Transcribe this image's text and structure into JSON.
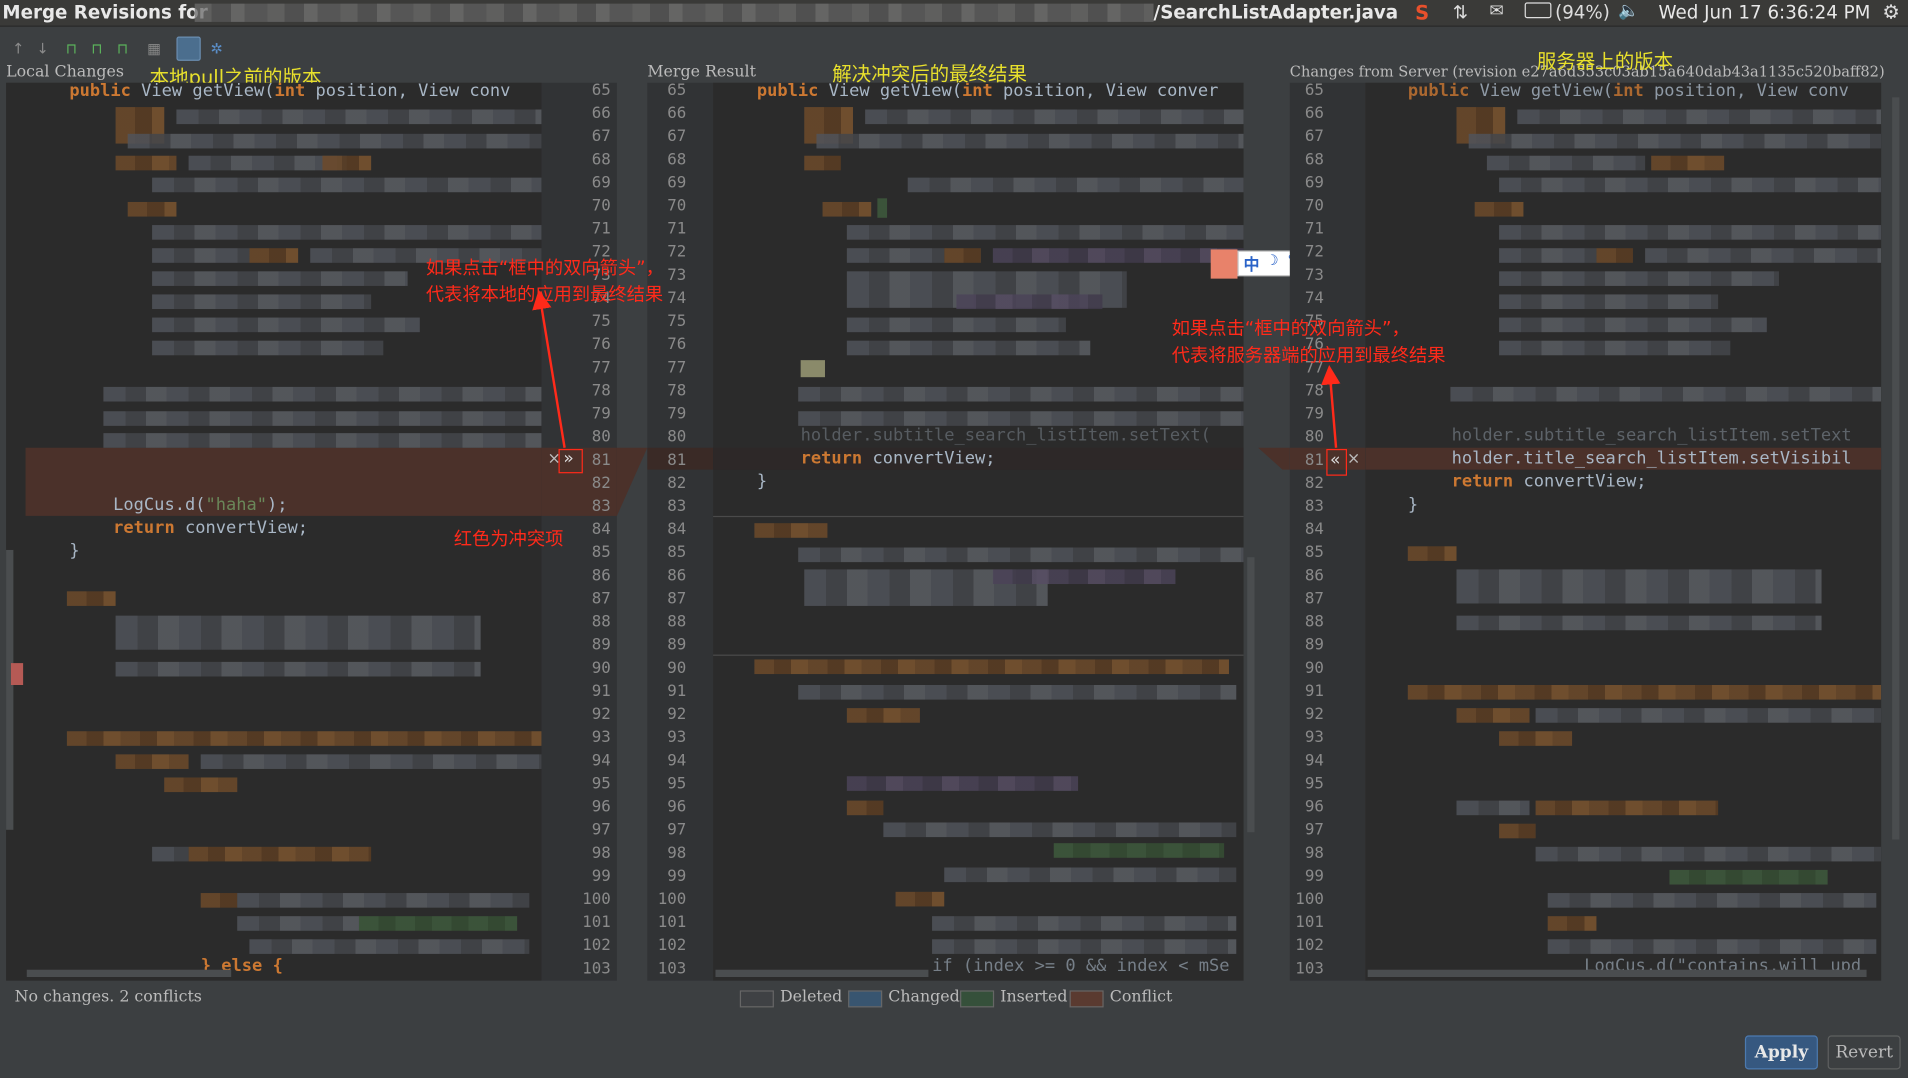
{
  "window": {
    "title_prefix": "Merge Revisions for",
    "file_suffix": "/SearchListAdapter.java",
    "battery": "(94%)",
    "clock": "Wed Jun 17  6:36:24 PM",
    "icons": [
      "sogou-s-icon",
      "network-icon",
      "mail-icon",
      "battery-icon",
      "volume-icon",
      "system-gear-icon"
    ]
  },
  "toolbar": {
    "icons": [
      "prev-arrow-icon",
      "next-arrow-icon",
      "apply-left-icon",
      "apply-all-icon",
      "apply-right-icon",
      "magic-resolve-icon",
      "layout-toggle-icon",
      "settings-icon"
    ]
  },
  "headers": {
    "local": "Local  Changes",
    "result": "Merge  Result",
    "server": "Changes  from  Server  (revision  e27a6d353c03ab15a640dab43a1135c520baff82)"
  },
  "annotations": {
    "local_version": "本地pull之前的版本",
    "result_version": "解决冲突后的最终结果",
    "server_version": "服务器上的版本",
    "left_arrow_line1": "如果点击“框中的双向箭头”，",
    "left_arrow_line2": "代表将本地的应用到最终结果",
    "right_arrow_line1": "如果点击“框中的双向箭头”，",
    "right_arrow_line2": "代表将服务器端的应用到最终结果",
    "conflict_note": "红色为冲突项"
  },
  "ime": {
    "label": "中",
    "icons": [
      "moon-icon",
      "punct-icon",
      "shirt-icon",
      "wrench-icon"
    ]
  },
  "line_numbers": [
    "65",
    "66",
    "67",
    "68",
    "69",
    "70",
    "71",
    "72",
    "73",
    "74",
    "75",
    "76",
    "77",
    "78",
    "79",
    "80",
    "81",
    "82",
    "83",
    "84",
    "85",
    "86",
    "87",
    "88",
    "89",
    "90",
    "91",
    "92",
    "93",
    "94",
    "95",
    "96",
    "97",
    "98",
    "99",
    "100",
    "101",
    "102",
    "103"
  ],
  "code": {
    "left_header_kw": "public",
    "left_header_rest": " View getView(",
    "left_header_kw2": "int",
    "left_header_rest2": " position, View conv",
    "left_logcus": "LogCus.d(",
    "left_logcus_str": "\"haha\"",
    "left_logcus_end": ");",
    "left_return_kw": "return",
    "left_return_rest": " convertView;",
    "left_brace": "}",
    "left_else": "} else {",
    "mid_header_kw": "public",
    "mid_header_rest": " View getView(",
    "mid_header_kw2": "int",
    "mid_header_rest2": " position, View conver",
    "mid_line80": "holder.subtitle_search_listItem.setText(",
    "mid_return_kw": "return",
    "mid_return_rest": " convertView;",
    "mid_brace": "}",
    "mid_line103": "if (index >= 0 && index < mSe",
    "right_header_kw": "public",
    "right_header_rest": " View getView(",
    "right_header_kw2": "int",
    "right_header_rest2": " position, View conv",
    "right_line80": "holder.subtitle_search_listItem.setText",
    "right_line81": "holder.title_search_listItem.setVisibil",
    "right_return_kw": "return",
    "right_return_rest": " convertView;",
    "right_brace": "}",
    "right_line103": "LogCus.d(\"contains,will upd"
  },
  "arrows": {
    "left": "»",
    "right": "«",
    "close": "×"
  },
  "status": {
    "text": "No changes. 2 conflicts"
  },
  "legend": [
    {
      "label": "Deleted",
      "color": "#3f4144"
    },
    {
      "label": "Changed",
      "color": "#385570"
    },
    {
      "label": "Inserted",
      "color": "#35503a"
    },
    {
      "label": "Conflict",
      "color": "#5a3a30"
    }
  ],
  "buttons": {
    "apply": "Apply",
    "revert": "Revert"
  },
  "colors": {
    "conflict_bg": "#4b312a",
    "annotation_red": "#ff2a1a",
    "annotation_yellow": "#e8e02c"
  }
}
